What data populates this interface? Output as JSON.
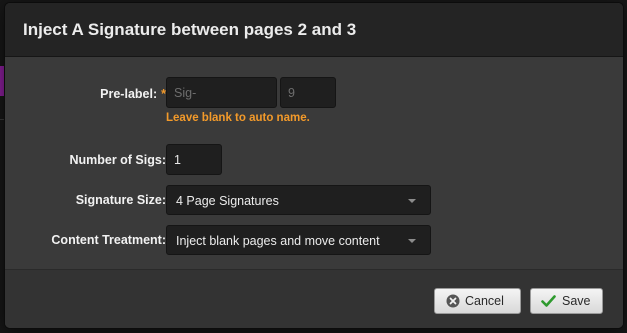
{
  "dialog": {
    "title": "Inject A Signature between pages 2 and 3"
  },
  "form": {
    "pre_label": {
      "label": "Pre-label:",
      "required_marker": "*",
      "prefix_placeholder": "Sig-",
      "number_placeholder": "9",
      "hint": "Leave blank to auto name."
    },
    "num_sigs": {
      "label": "Number of Sigs:",
      "value": "1"
    },
    "signature_size": {
      "label": "Signature Size:",
      "selected": "4 Page Signatures"
    },
    "content_treatment": {
      "label": "Content Treatment:",
      "selected": "Inject blank pages and move content"
    }
  },
  "footer": {
    "cancel_label": "Cancel",
    "save_label": "Save"
  },
  "colors": {
    "accent_orange": "#f39a2a",
    "save_check_green": "#2e9a2e",
    "cancel_icon_gray": "#555555",
    "backdrop_accent_purple": "#8a1f9a"
  },
  "icons": {
    "cancel": "x-circle-icon",
    "save": "check-icon",
    "dropdown": "chevron-down-icon"
  }
}
